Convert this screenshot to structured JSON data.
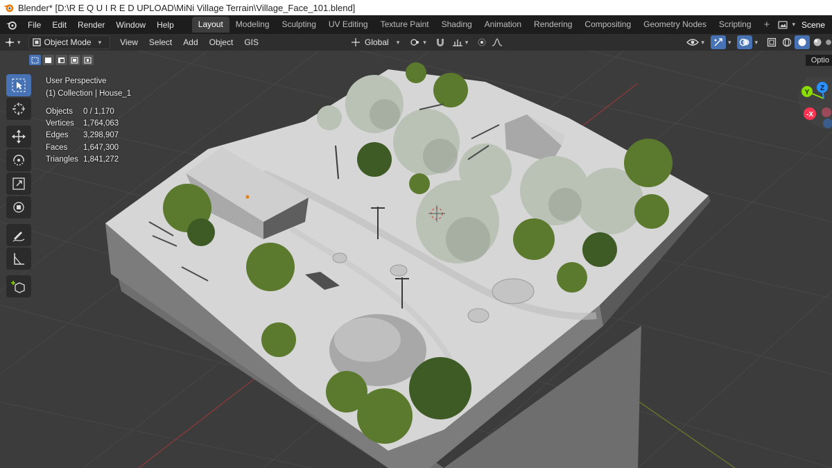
{
  "window": {
    "title": "Blender* [D:\\R E Q U I R E D   UPLOAD\\MiNi Village Terrain\\Village_Face_101.blend]"
  },
  "menu": {
    "items": [
      "File",
      "Edit",
      "Render",
      "Window",
      "Help"
    ]
  },
  "workspaces": {
    "tabs": [
      "Layout",
      "Modeling",
      "Sculpting",
      "UV Editing",
      "Texture Paint",
      "Shading",
      "Animation",
      "Rendering",
      "Compositing",
      "Geometry Nodes",
      "Scripting"
    ],
    "active": "Layout",
    "add": "+"
  },
  "scene": {
    "name": "Scene"
  },
  "header": {
    "mode": "Object Mode",
    "menus": [
      "View",
      "Select",
      "Add",
      "Object",
      "GIS"
    ],
    "orientation": "Global"
  },
  "overlay": {
    "perspective": "User Perspective",
    "collection": "(1) Collection | House_1"
  },
  "stats": {
    "rows": [
      {
        "label": "Objects",
        "value": "0 / 1,170"
      },
      {
        "label": "Vertices",
        "value": "1,764,063"
      },
      {
        "label": "Edges",
        "value": "3,298,907"
      },
      {
        "label": "Faces",
        "value": "1,647,300"
      },
      {
        "label": "Triangles",
        "value": "1,841,272"
      }
    ]
  },
  "gizmo": {
    "y": "Y",
    "z": "Z",
    "x": "-X"
  },
  "options_label": "Optio",
  "colors": {
    "accent": "#4772b3",
    "topbar": "#1d1d1d",
    "header": "#2e2e2e",
    "viewport": "#3c3c3c",
    "gizmo_x": "#ff3352",
    "gizmo_y": "#8bdc00",
    "gizmo_z": "#2890ff"
  }
}
